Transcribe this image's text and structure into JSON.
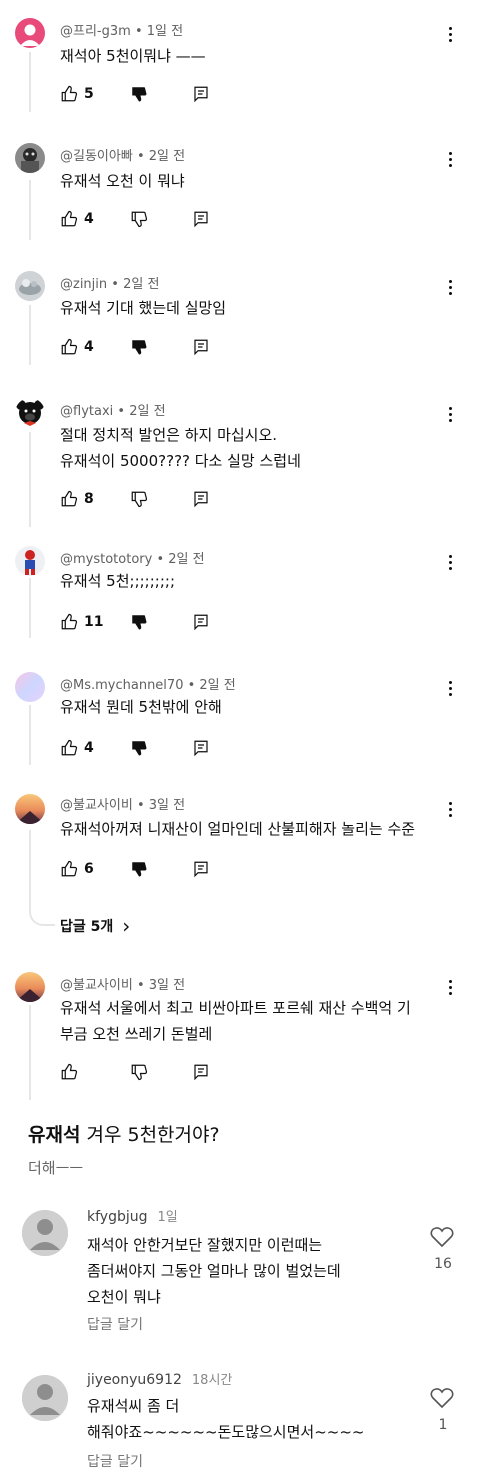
{
  "comments": [
    {
      "author": "@프리-g3m",
      "time": "1일 전",
      "text": "재석아 5천이뭐냐 ——",
      "likes": "5",
      "disliked": true
    },
    {
      "author": "@길동이아빠",
      "time": "2일 전",
      "text": "유재석   오천 이 뭐냐",
      "likes": "4",
      "disliked": false
    },
    {
      "author": "@zinjin",
      "time": "2일 전",
      "text": "유재석  기대 했는데  실망임",
      "likes": "4",
      "disliked": true
    },
    {
      "author": "@flytaxi",
      "time": "2일 전",
      "text": "절대 정치적 발언은 하지 마십시오.\n유재석이 5000???? 다소 실망 스럽네",
      "likes": "8",
      "disliked": false
    },
    {
      "author": "@mystototory",
      "time": "2일 전",
      "text": "유재석 5천;;;;;;;;;",
      "likes": "11",
      "disliked": true
    },
    {
      "author": "@Ms.mychannel70",
      "time": "2일 전",
      "text": "유재석 뭔데 5천밖에 안해",
      "likes": "4",
      "disliked": true
    },
    {
      "author": "@불교사이비",
      "time": "3일 전",
      "text": "유재석아꺼져 니재산이 얼마인데 산불피해자 놀리는 수준",
      "likes": "6",
      "disliked": true
    },
    {
      "author": "@불교사이비",
      "time": "3일 전",
      "text": "유재석 서울에서 최고 비싼아파트 포르쉐 재산 수백억 기\n부금 오천 쓰레기 돈벌레",
      "likes": "",
      "disliked": false
    }
  ],
  "replies_toggle": {
    "label": "답글 5개",
    "chevron": "›"
  },
  "post": {
    "title_strong": "유재석",
    "title_rest": " 겨우 5천한거야?",
    "subtitle": "더해ㅡㅡ"
  },
  "replies": [
    {
      "user": "kfygbjug",
      "time": "1일",
      "text": "재석아 안한거보단 잘했지만 이런때는\n좀더써야지 그동안 얼마나 많이 벌었는데\n오천이 뭐냐",
      "reply_label": "답글 달기",
      "likes": "16"
    },
    {
      "user": "jiyeonyu6912",
      "time": "18시간",
      "text": "유재석씨 좀 더\n해줘야죠~~~~~~돈도많으시면서~~~~",
      "reply_label": "답글 달기",
      "likes": "1"
    }
  ],
  "colors": {
    "text": "#0f0f0f",
    "secondary": "#606060",
    "line": "#e6e6e6"
  }
}
